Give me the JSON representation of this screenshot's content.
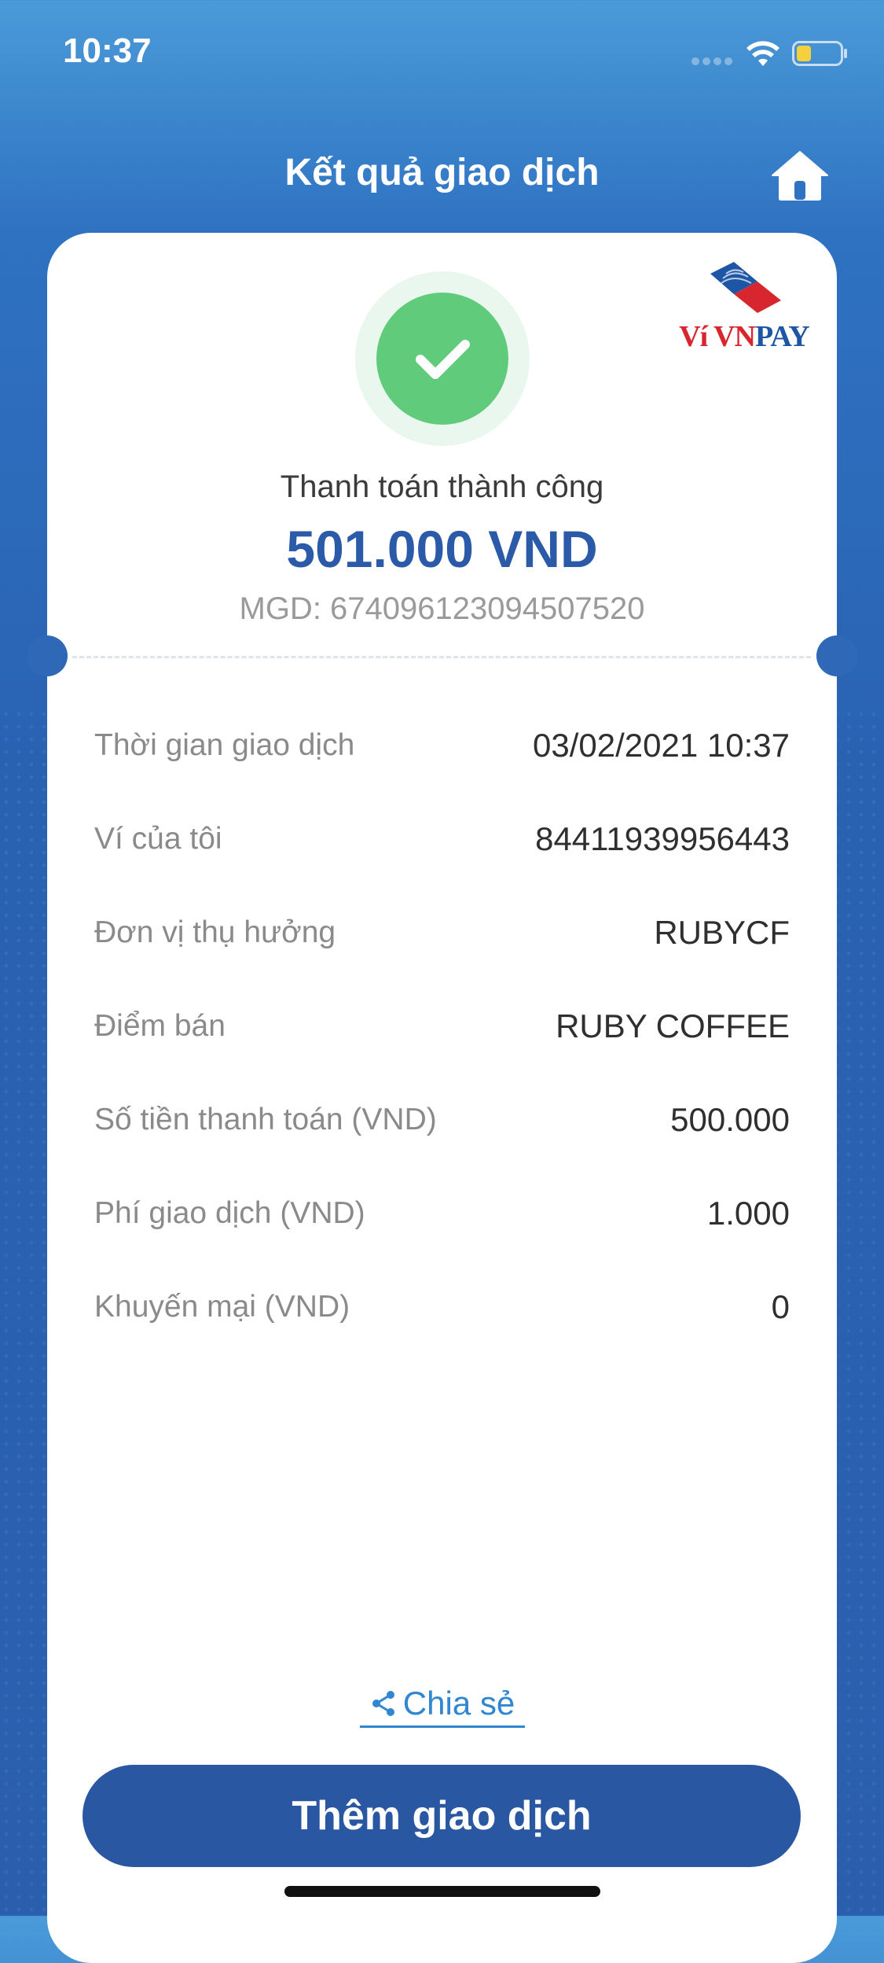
{
  "status_bar": {
    "time": "10:37"
  },
  "header": {
    "title": "Kết quả giao dịch"
  },
  "brand": {
    "logo_vi": "Ví ",
    "logo_vn": "VN",
    "logo_pay": "PAY",
    "colors": {
      "red": "#d7262e",
      "blue": "#1e56a6"
    }
  },
  "result": {
    "status": "Thanh toán thành công",
    "amount": "501.000 VND",
    "mgd": "MGD: 674096123094507520",
    "icon": "check-icon",
    "color": "#5fcb7b"
  },
  "details": [
    {
      "label": "Thời gian giao dịch",
      "value": "03/02/2021 10:37"
    },
    {
      "label": "Ví của tôi",
      "value": "84411939956443"
    },
    {
      "label": "Đơn vị thụ hưởng",
      "value": "RUBYCF"
    },
    {
      "label": "Điểm bán",
      "value": "RUBY COFFEE"
    },
    {
      "label": "Số tiền thanh toán (VND)",
      "value": "500.000"
    },
    {
      "label": "Phí giao dịch (VND)",
      "value": "1.000"
    },
    {
      "label": "Khuyến mại (VND)",
      "value": "0"
    }
  ],
  "actions": {
    "share_label": "Chia sẻ",
    "primary_label": "Thêm giao dịch",
    "primary_color": "#2a57a1"
  }
}
